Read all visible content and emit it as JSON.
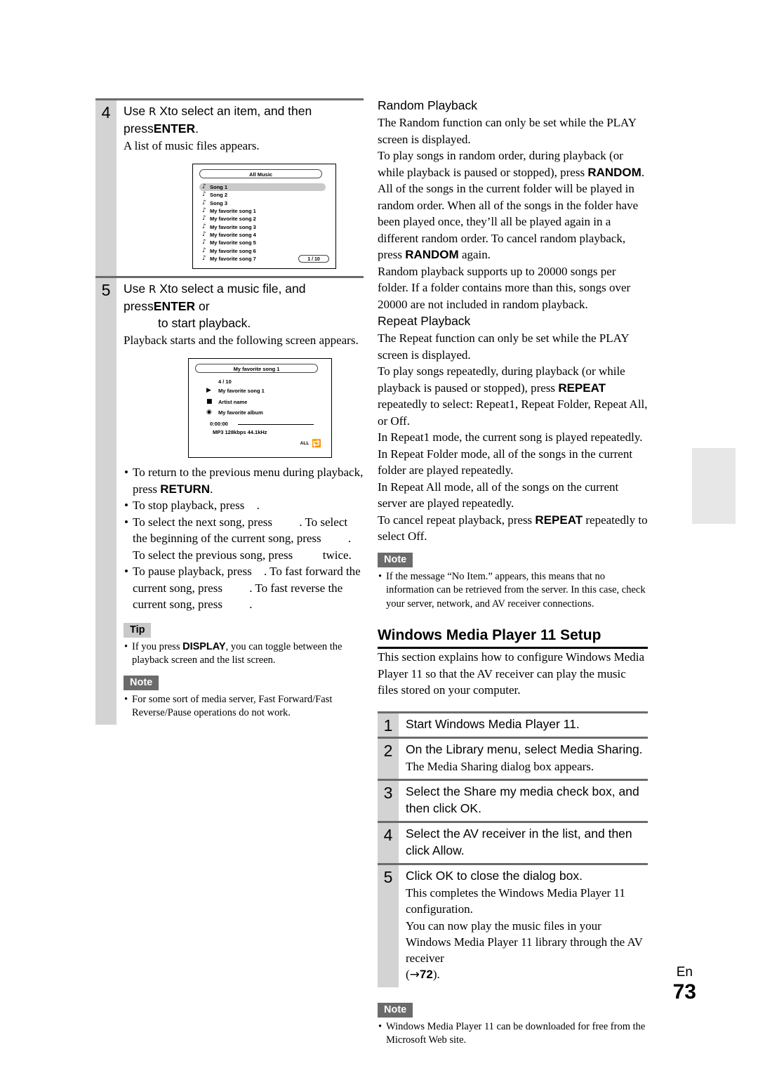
{
  "page": {
    "language_label": "En",
    "page_number": "73"
  },
  "left_column": {
    "steps": [
      {
        "number": "4",
        "head_pre": "Use ",
        "head_sym1": "R",
        "head_mid": " X",
        "head_mid2": "to select an item, and then press",
        "head_kbd": "ENTER",
        "head_post": ".",
        "sub": "A list of music files appears."
      },
      {
        "number": "5",
        "head_pre": "Use ",
        "head_sym1": "R",
        "head_mid": " X",
        "head_mid2": "to select a music file, and press",
        "head_kbd": "ENTER",
        "head_post": " or",
        "head_line2": "to start playback.",
        "sub": "Playback starts and the following screen appears."
      }
    ],
    "list_screen": {
      "title": "All Music",
      "rows": [
        "Song 1",
        "Song 2",
        "Song 3",
        "My favorite song 1",
        "My favorite song 2",
        "My favorite song 3",
        "My favorite song 4",
        "My favorite song 5",
        "My favorite song 6",
        "My favorite song 7"
      ],
      "selected_index": 0,
      "note_icon": "music-note-icon",
      "page_indicator": "1 / 10"
    },
    "play_screen": {
      "title": "My favorite song 1",
      "track_number": "4 / 10",
      "track_title": "My favorite song 1",
      "artist": "Artist name",
      "album": "My favorite album",
      "elapsed_time": "0:00:00",
      "format": "MP3 128kbps 44.1kHz",
      "repeat_label": "ALL"
    },
    "bullets": [
      {
        "parts": [
          {
            "t": "To return to the previous menu during playback, press "
          },
          {
            "b": "RETURN"
          },
          {
            "t": "."
          }
        ]
      },
      {
        "parts": [
          {
            "t": "To stop playback, press "
          },
          {
            "g": "stop-button-glyph"
          },
          {
            "t": "."
          }
        ]
      },
      {
        "parts": [
          {
            "t": "To select the next song, press "
          },
          {
            "g": "next-button-glyph"
          },
          {
            "t": ". To select the beginning of the current song, press "
          },
          {
            "g": "previous-button-glyph"
          },
          {
            "t": ". To select the previous song, press "
          },
          {
            "g": "previous-button-glyph-2"
          },
          {
            "t": " twice."
          }
        ]
      },
      {
        "parts": [
          {
            "t": "To pause playback, press "
          },
          {
            "g": "pause-button-glyph"
          },
          {
            "t": ". To fast forward the current song, press "
          },
          {
            "g": "fast-forward-glyph"
          },
          {
            "t": ". To fast reverse the current song, press "
          },
          {
            "g": "fast-reverse-glyph"
          },
          {
            "t": "."
          }
        ]
      }
    ],
    "tip": {
      "label": "Tip",
      "bullet_pre": "If you press ",
      "bullet_kbd": "DISPLAY",
      "bullet_post": ", you can toggle between the playback screen and the list screen."
    },
    "note": {
      "label": "Note",
      "bullet": "For some sort of media server, Fast Forward/Fast Reverse/Pause operations do not work."
    }
  },
  "right_column": {
    "random_playback": {
      "heading": "Random Playback",
      "p1": "The Random function can only be set while the PLAY screen is displayed.",
      "p2_a": "To play songs in random order, during playback (or while playback is paused or stopped), press ",
      "p2_kbd1": "RANDOM",
      "p2_b": ". All of the songs in the current folder will be played in random order. When all of the songs in the folder have been played once, they’ll all be played again in a different random order. To cancel random playback, press ",
      "p2_kbd2": "RANDOM",
      "p2_c": " again.",
      "p3": "Random playback supports up to 20000 songs per folder. If a folder contains more than this, songs over 20000 are not included in random playback."
    },
    "repeat_playback": {
      "heading": "Repeat Playback",
      "p1": "The Repeat function can only be set while the PLAY screen is displayed.",
      "p2_a": "To play songs repeatedly, during playback (or while playback is paused or stopped), press ",
      "p2_kbd": "REPEAT",
      "p2_b": " repeatedly to select: Repeat1, Repeat Folder, Repeat All, or Off.",
      "p3": "In Repeat1 mode, the current song is played repeatedly.",
      "p4": "In Repeat Folder mode, all of the songs in the current folder are played repeatedly.",
      "p5": "In Repeat All mode, all of the songs on the current server are played repeatedly.",
      "p6_a": "To cancel repeat playback, press ",
      "p6_kbd": "REPEAT",
      "p6_b": " repeatedly to select Off."
    },
    "note_top": {
      "label": "Note",
      "bullet": "If the message “No Item.” appears, this means that no information can be retrieved from the server. In this case, check your server, network, and AV receiver connections."
    },
    "wmp_section": {
      "heading": "Windows Media Player 11 Setup",
      "intro": "This section explains how to configure Windows Media Player 11 so that the AV receiver can play the music files stored on your computer.",
      "steps": [
        {
          "number": "1",
          "head": "Start Windows Media Player 11.",
          "subs": []
        },
        {
          "number": "2",
          "head": "On the Library menu, select Media Sharing.",
          "subs": [
            "The Media Sharing dialog box appears."
          ]
        },
        {
          "number": "3",
          "head": "Select the Share my media check box, and then click OK.",
          "subs": []
        },
        {
          "number": "4",
          "head": "Select the AV receiver in the list, and then click Allow.",
          "subs": []
        },
        {
          "number": "5",
          "head": "Click OK to close the dialog box.",
          "subs": [
            "This completes the Windows Media Player 11 configuration.",
            "You can now play the music files in your Windows Media Player 11 library through the AV receiver"
          ],
          "ref_open": "(",
          "ref_arrow": "→",
          "ref_page": "72",
          "ref_close": ")."
        }
      ]
    },
    "note_bottom": {
      "label": "Note",
      "bullet": "Windows Media Player 11 can be downloaded for free from the Microsoft Web site."
    }
  }
}
